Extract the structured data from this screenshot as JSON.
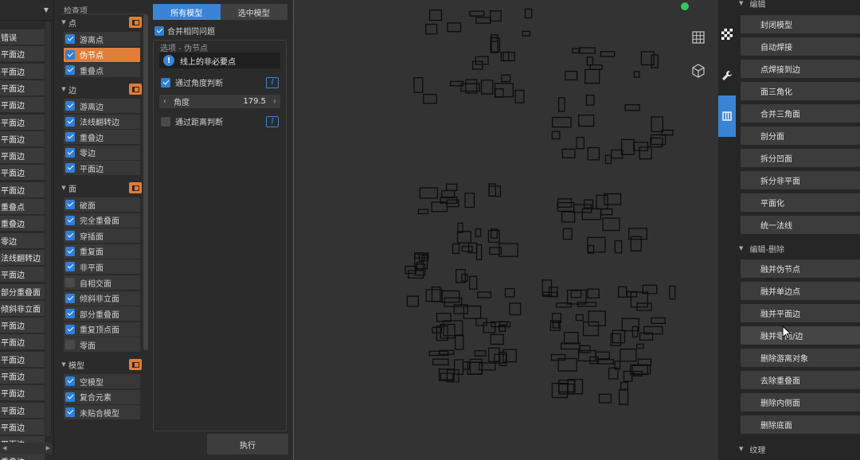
{
  "results": {
    "dropdown_icon": "caret-down",
    "items": [
      "错误",
      "平面边",
      "平面边",
      "平面边",
      "平面边",
      "平面边",
      "平面边",
      "平面边",
      "平面边",
      "平面边",
      "重叠点",
      "重叠边",
      "零边",
      "法线翻转边",
      "平面边",
      "部分重叠面",
      "倾斜非立面",
      "平面边",
      "平面边",
      "平面边",
      "平面边",
      "平面边",
      "平面边",
      "平面边",
      "平面边",
      "重叠边"
    ]
  },
  "checks": {
    "header": "检查项",
    "groups": [
      {
        "label": "点",
        "items": [
          {
            "label": "游离点",
            "checked": true,
            "selected": false
          },
          {
            "label": "伪节点",
            "checked": true,
            "selected": true
          },
          {
            "label": "重叠点",
            "checked": true,
            "selected": false
          }
        ]
      },
      {
        "label": "边",
        "items": [
          {
            "label": "游离边",
            "checked": true,
            "selected": false
          },
          {
            "label": "法线翻转边",
            "checked": true,
            "selected": false
          },
          {
            "label": "重叠边",
            "checked": true,
            "selected": false
          },
          {
            "label": "零边",
            "checked": true,
            "selected": false
          },
          {
            "label": "平面边",
            "checked": true,
            "selected": false
          }
        ]
      },
      {
        "label": "面",
        "items": [
          {
            "label": "破面",
            "checked": true,
            "selected": false
          },
          {
            "label": "完全重叠面",
            "checked": true,
            "selected": false
          },
          {
            "label": "穿插面",
            "checked": true,
            "selected": false
          },
          {
            "label": "重复面",
            "checked": true,
            "selected": false
          },
          {
            "label": "非平面",
            "checked": true,
            "selected": false
          },
          {
            "label": "自相交面",
            "checked": false,
            "selected": false
          },
          {
            "label": "倾斜非立面",
            "checked": true,
            "selected": false
          },
          {
            "label": "部分重叠面",
            "checked": true,
            "selected": false
          },
          {
            "label": "重复顶点面",
            "checked": true,
            "selected": false
          },
          {
            "label": "零面",
            "checked": false,
            "selected": false
          }
        ]
      },
      {
        "label": "模型",
        "items": [
          {
            "label": "空模型",
            "checked": true,
            "selected": false
          },
          {
            "label": "复合元素",
            "checked": true,
            "selected": false
          },
          {
            "label": "未贴合模型",
            "checked": true,
            "selected": false
          }
        ]
      }
    ]
  },
  "options": {
    "tab_all": "所有模型",
    "tab_selected": "选中模型",
    "merge_label": "合并相同问题",
    "merge_checked": true,
    "frame_title": "选项 - 伪节点",
    "info_text": "线上的非必要点",
    "angle_check_label": "通过角度判断",
    "angle_checked": true,
    "angle_name": "角度",
    "angle_value": "179.5",
    "distance_check_label": "通过距离判断",
    "distance_checked": false,
    "run_label": "执行"
  },
  "viewport": {
    "status_color": "#35c75a",
    "grid_icon": "grid-icon",
    "cube_icon": "cube-icon"
  },
  "toolbar": {
    "icons": [
      "checker-icon",
      "wrench-icon",
      "book-icon"
    ]
  },
  "edit": {
    "section_edit": "编辑",
    "edit_items": [
      "封闭模型",
      "自动焊接",
      "点焊接到边",
      "面三角化",
      "合并三角面",
      "剖分面",
      "拆分凹面",
      "拆分非平面",
      "平面化",
      "统一法线"
    ],
    "section_delete": "编辑-删除",
    "delete_items": [
      "融并伪节点",
      "融并单边点",
      "融并平面边",
      "融并零面/边",
      "删除游离对象",
      "去除重叠面",
      "删除内侧面",
      "删除底面"
    ],
    "section_texture": "纹理"
  },
  "colors": {
    "accent_blue": "#3a84d6",
    "accent_orange": "#e07d3a"
  }
}
